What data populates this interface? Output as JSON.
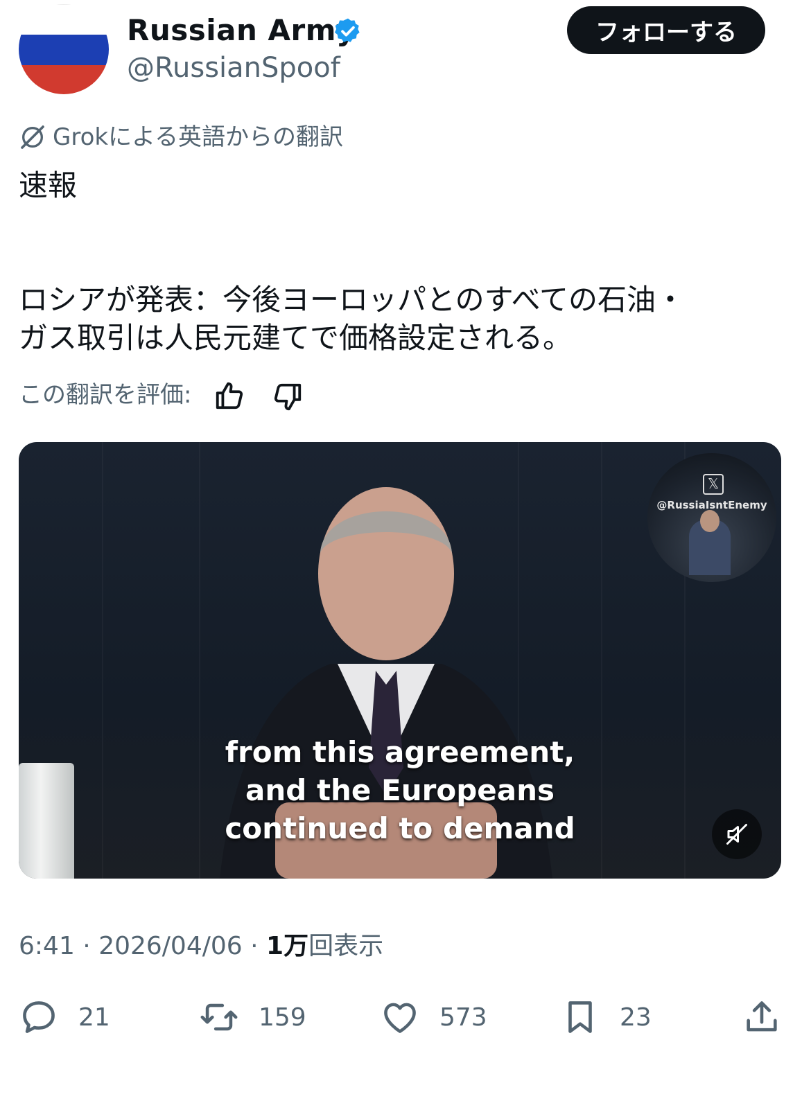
{
  "author": {
    "name": "Russian Army",
    "handle": "@RussianSpoof",
    "verified": true,
    "avatar_colors": [
      "#ffffff",
      "#1c3fb3",
      "#d13a2f"
    ]
  },
  "follow_button": {
    "label": "フォローする"
  },
  "translation": {
    "label": "Grokによる英語からの翻訳",
    "rate_label": "この翻訳を評価:"
  },
  "tweet": {
    "text": "速報\n\n\nロシアが発表：今後ヨーロッパとのすべての石油・\nガス取引は人民元建てで価格設定される。"
  },
  "media": {
    "caption_lines": [
      "from this agreement,",
      "and the Europeans",
      "continued to demand"
    ],
    "pip_handle": "@RussiaIsntEnemy"
  },
  "meta": {
    "time": "6:41",
    "date": "2026/04/06",
    "views_count": "1万",
    "views_label": "回表示"
  },
  "actions": {
    "replies": "21",
    "reposts": "159",
    "likes": "573",
    "bookmarks": "23"
  },
  "colors": {
    "text_primary": "#0f1419",
    "text_secondary": "#536471",
    "verified_blue": "#1d9bf0"
  }
}
